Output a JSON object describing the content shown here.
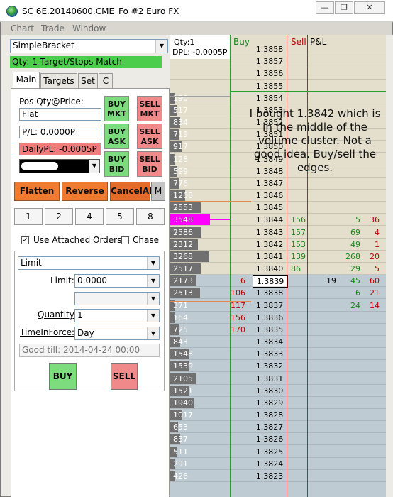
{
  "window": {
    "title": "SC 6E.20140600.CME_Fo  #2  Euro FX",
    "controls": {
      "minimize": "—",
      "restore": "❐",
      "close": "✕"
    }
  },
  "menu": [
    "Chart",
    "Trade",
    "Window"
  ],
  "panel": {
    "strategy": "SimpleBracket",
    "qty_match": "Qty: 1 Target/Stops Match",
    "tabs": [
      "Main",
      "Targets",
      "Set",
      "C"
    ],
    "pos_label": "Pos Qty@Price:",
    "pos_value": "Flat",
    "pl_value": "P/L: 0.0000P",
    "daily_pl": "DailyPL: -0.0005P",
    "buttons": {
      "buy_mkt": [
        "BUY",
        "MKT"
      ],
      "sell_mkt": [
        "SELL",
        "MKT"
      ],
      "buy_ask": [
        "BUY",
        "ASK"
      ],
      "sell_ask": [
        "SELL",
        "ASK"
      ],
      "buy_bid": [
        "BUY",
        "BID"
      ],
      "sell_bid": [
        "SELL",
        "BID"
      ]
    },
    "flatten": "Flatten",
    "reverse": "Reverse",
    "cancel_all": "CancelAll",
    "m": "M",
    "qty_buttons": [
      "1",
      "2",
      "4",
      "5",
      "8"
    ],
    "use_attached": "Use Attached Orders",
    "use_attached_checked": true,
    "chase": "Chase",
    "chase_checked": false,
    "order_type": "Limit",
    "limit_label": "Limit:",
    "limit_value": "0.0000",
    "quantity_label": "Quantity:",
    "quantity_value": "1",
    "tif_label": "TimeInForce:",
    "tif_value": "Day",
    "good_till": "Good till: 2014-04-24 00:00",
    "buy": "BUY",
    "sell": "SELL"
  },
  "ladder": {
    "qty_label": "Qty:1",
    "dpl_label": "DPL: -0.0005P",
    "col_buy": "Buy",
    "col_sell": "Sell",
    "col_pl": "P&L",
    "annotation": "I bought 1.3842 which is in the middle of the volume cluster. Not a good idea. Buy/sell the edges.",
    "current_price": "1.3839",
    "current_trade": "19",
    "rows": [
      {
        "price": "1.3858",
        "vol": "",
        "bv": "",
        "sv": "",
        "p1": "",
        "p2": ""
      },
      {
        "price": "1.3857",
        "vol": "",
        "bv": "",
        "sv": "",
        "p1": "",
        "p2": ""
      },
      {
        "price": "1.3856",
        "vol": "",
        "bv": "",
        "sv": "",
        "p1": "",
        "p2": ""
      },
      {
        "price": "1.3855",
        "vol": "",
        "bv": "",
        "sv": "",
        "p1": "",
        "p2": ""
      },
      {
        "price": "1.3854",
        "vol": "190",
        "bv": "",
        "sv": "",
        "p1": "",
        "p2": ""
      },
      {
        "price": "1.3853",
        "vol": "517",
        "bv": "",
        "sv": "",
        "p1": "",
        "p2": ""
      },
      {
        "price": "1.3852",
        "vol": "834",
        "bv": "",
        "sv": "",
        "p1": "",
        "p2": ""
      },
      {
        "price": "1.3851",
        "vol": "719",
        "bv": "",
        "sv": "",
        "p1": "",
        "p2": ""
      },
      {
        "price": "1.3850",
        "vol": "917",
        "bv": "",
        "sv": "",
        "p1": "",
        "p2": ""
      },
      {
        "price": "1.3849",
        "vol": "128",
        "bv": "",
        "sv": "",
        "p1": "",
        "p2": ""
      },
      {
        "price": "1.3848",
        "vol": "599",
        "bv": "",
        "sv": "",
        "p1": "",
        "p2": ""
      },
      {
        "price": "1.3847",
        "vol": "776",
        "bv": "",
        "sv": "",
        "p1": "",
        "p2": ""
      },
      {
        "price": "1.3846",
        "vol": "1268",
        "bv": "",
        "sv": "",
        "p1": "",
        "p2": ""
      },
      {
        "price": "1.3845",
        "vol": "2553",
        "bv": "",
        "sv": "",
        "p1": "",
        "p2": ""
      },
      {
        "price": "1.3844",
        "vol": "3548",
        "bv": "156",
        "sv": "",
        "p1": "5",
        "p2": "36"
      },
      {
        "price": "1.3843",
        "vol": "2586",
        "bv": "157",
        "sv": "",
        "p1": "69",
        "p2": "4"
      },
      {
        "price": "1.3842",
        "vol": "2312",
        "bv": "153",
        "sv": "",
        "p1": "49",
        "p2": "1"
      },
      {
        "price": "1.3841",
        "vol": "3268",
        "bv": "139",
        "sv": "",
        "p1": "268",
        "p2": "20"
      },
      {
        "price": "1.3840",
        "vol": "2517",
        "bv": "86",
        "sv": "",
        "p1": "29",
        "p2": "5"
      },
      {
        "price": "1.3839",
        "vol": "2173",
        "bv": "",
        "sv": "6",
        "p1": "45",
        "p2": "60"
      },
      {
        "price": "1.3838",
        "vol": "2513",
        "bv": "",
        "sv": "106",
        "p1": "6",
        "p2": "21"
      },
      {
        "price": "1.3837",
        "vol": "371",
        "bv": "",
        "sv": "117",
        "p1": "24",
        "p2": "14"
      },
      {
        "price": "1.3836",
        "vol": "164",
        "bv": "",
        "sv": "156",
        "p1": "",
        "p2": ""
      },
      {
        "price": "1.3835",
        "vol": "725",
        "bv": "",
        "sv": "170",
        "p1": "",
        "p2": ""
      },
      {
        "price": "1.3834",
        "vol": "843",
        "bv": "",
        "sv": "",
        "p1": "",
        "p2": ""
      },
      {
        "price": "1.3833",
        "vol": "1548",
        "bv": "",
        "sv": "",
        "p1": "",
        "p2": ""
      },
      {
        "price": "1.3832",
        "vol": "1539",
        "bv": "",
        "sv": "",
        "p1": "",
        "p2": ""
      },
      {
        "price": "1.3831",
        "vol": "2105",
        "bv": "",
        "sv": "",
        "p1": "",
        "p2": ""
      },
      {
        "price": "1.3830",
        "vol": "1521",
        "bv": "",
        "sv": "",
        "p1": "",
        "p2": ""
      },
      {
        "price": "1.3829",
        "vol": "1940",
        "bv": "",
        "sv": "",
        "p1": "",
        "p2": ""
      },
      {
        "price": "1.3828",
        "vol": "1017",
        "bv": "",
        "sv": "",
        "p1": "",
        "p2": ""
      },
      {
        "price": "1.3827",
        "vol": "653",
        "bv": "",
        "sv": "",
        "p1": "",
        "p2": ""
      },
      {
        "price": "1.3826",
        "vol": "837",
        "bv": "",
        "sv": "",
        "p1": "",
        "p2": ""
      },
      {
        "price": "1.3825",
        "vol": "511",
        "bv": "",
        "sv": "",
        "p1": "",
        "p2": ""
      },
      {
        "price": "1.3824",
        "vol": "291",
        "bv": "",
        "sv": "",
        "p1": "",
        "p2": ""
      },
      {
        "price": "1.3823",
        "vol": "426",
        "bv": "",
        "sv": "",
        "p1": "",
        "p2": ""
      }
    ],
    "colors": {
      "upper_bg": "#e3dfcc",
      "lower_bg": "#bfcbd3",
      "buy_text": "#1a8a1a",
      "sell_text": "#c00000",
      "highlight": "#ff00ff",
      "current": "#ffffff"
    }
  }
}
